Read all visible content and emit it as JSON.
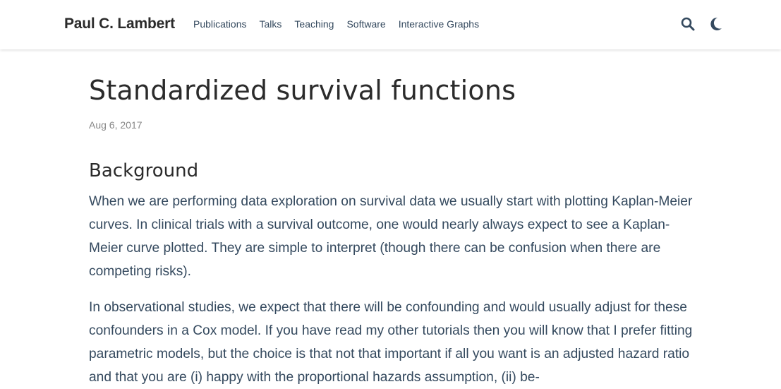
{
  "navbar": {
    "brand": "Paul C. Lambert",
    "links": [
      {
        "label": "Publications"
      },
      {
        "label": "Talks"
      },
      {
        "label": "Teaching"
      },
      {
        "label": "Software"
      },
      {
        "label": "Interactive Graphs"
      }
    ],
    "icons": {
      "search": "search-icon",
      "theme": "moon-icon"
    }
  },
  "article": {
    "title": "Standardized survival functions",
    "date": "Aug 6, 2017",
    "section_heading": "Background",
    "paragraphs": [
      "When we are performing data exploration on survival data we usually start with plotting Kaplan-Meier curves. In clinical trials with a survival outcome, one would nearly always expect to see a Kaplan-Meier curve plotted. They are simple to interpret (though there can be confusion when there are competing risks).",
      "In observational studies, we expect that there will be confounding and would usually adjust for these confounders in a Cox model. If you have read my other tutorials then you will know that I prefer fitting parametric models, but the choice is that not that important if all you want is an adjusted hazard ratio and that you are (i) happy with the proportional hazards assumption, (ii) be-"
    ]
  },
  "colors": {
    "text": "#34495e",
    "heading": "#2b2b2b",
    "muted": "#888888",
    "background": "#ffffff"
  }
}
